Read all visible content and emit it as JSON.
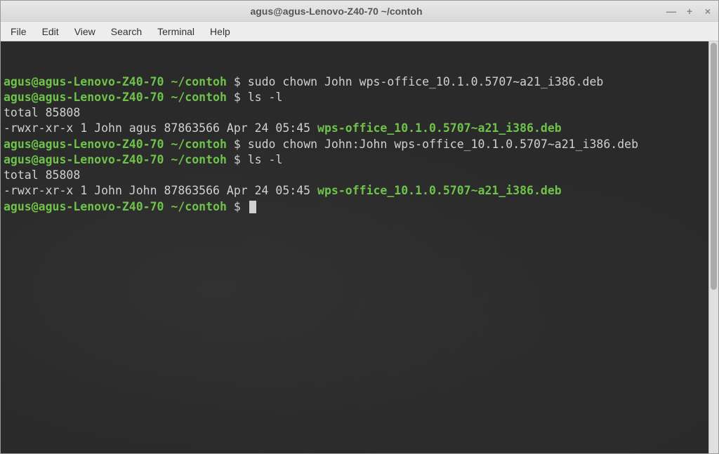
{
  "window": {
    "title": "agus@agus-Lenovo-Z40-70 ~/contoh"
  },
  "menubar": {
    "items": [
      "File",
      "Edit",
      "View",
      "Search",
      "Terminal",
      "Help"
    ]
  },
  "prompt": {
    "user_host": "agus@agus-Lenovo-Z40-70",
    "path": "~/contoh",
    "symbol": "$"
  },
  "lines": {
    "cmd1": "sudo chown John wps-office_10.1.0.5707~a21_i386.deb",
    "cmd2": "ls -l",
    "out2a": "total 85808",
    "out2b_perm": "-rwxr-xr-x 1 John agus 87863566 Apr 24 05:45 ",
    "out2b_file": "wps-office_10.1.0.5707~a21_i386.deb",
    "cmd3": "sudo chown John:John wps-office_10.1.0.5707~a21_i386.deb",
    "cmd4": "ls -l",
    "out4a": "total 85808",
    "out4b_perm": "-rwxr-xr-x 1 John John 87863566 Apr 24 05:45 ",
    "out4b_file": "wps-office_10.1.0.5707~a21_i386.deb"
  }
}
